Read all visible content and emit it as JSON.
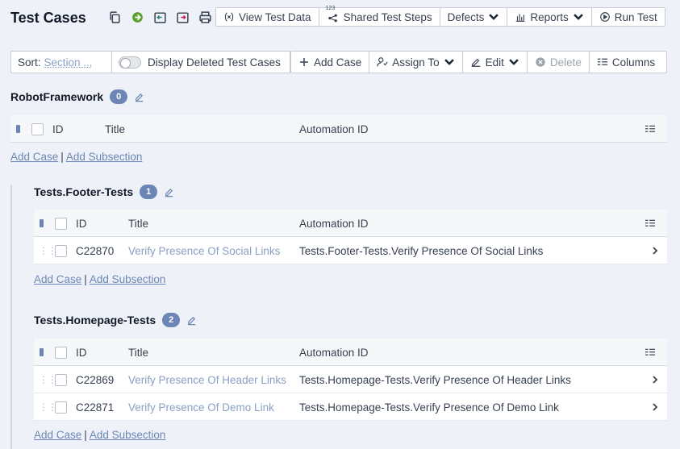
{
  "header": {
    "title": "Test Cases",
    "buttons": [
      {
        "label": "View Test Data"
      },
      {
        "label": "Shared Test Steps",
        "badge": "123"
      },
      {
        "label": "Defects"
      },
      {
        "label": "Reports"
      },
      {
        "label": "Run Test"
      }
    ]
  },
  "toolbar": {
    "sort_label": "Sort:",
    "sort_value": "Section ...",
    "display_deleted": "Display Deleted Test Cases",
    "add_case": "Add Case",
    "assign_to": "Assign To",
    "edit": "Edit",
    "delete": "Delete",
    "columns": "Columns"
  },
  "columns": {
    "id": "ID",
    "title": "Title",
    "automation_id": "Automation ID"
  },
  "links": {
    "add_case": "Add Case",
    "separator": "|",
    "add_subsection": "Add Subsection"
  },
  "sections": [
    {
      "name": "RobotFramework",
      "count": "0",
      "rows": []
    },
    {
      "name": "Tests.Footer-Tests",
      "count": "1",
      "rows": [
        {
          "id": "C22870",
          "title": "Verify Presence Of Social Links",
          "automation_id": "Tests.Footer-Tests.Verify Presence Of Social Links"
        }
      ]
    },
    {
      "name": "Tests.Homepage-Tests",
      "count": "2",
      "rows": [
        {
          "id": "C22869",
          "title": "Verify Presence Of Header Links",
          "automation_id": "Tests.Homepage-Tests.Verify Presence Of Header Links"
        },
        {
          "id": "C22871",
          "title": "Verify Presence Of Demo Link",
          "automation_id": "Tests.Homepage-Tests.Verify Presence Of Demo Link"
        }
      ]
    }
  ],
  "colors": {
    "accent": "#6b86b5",
    "link": "#8aa0c4",
    "background": "#eef2f8"
  }
}
